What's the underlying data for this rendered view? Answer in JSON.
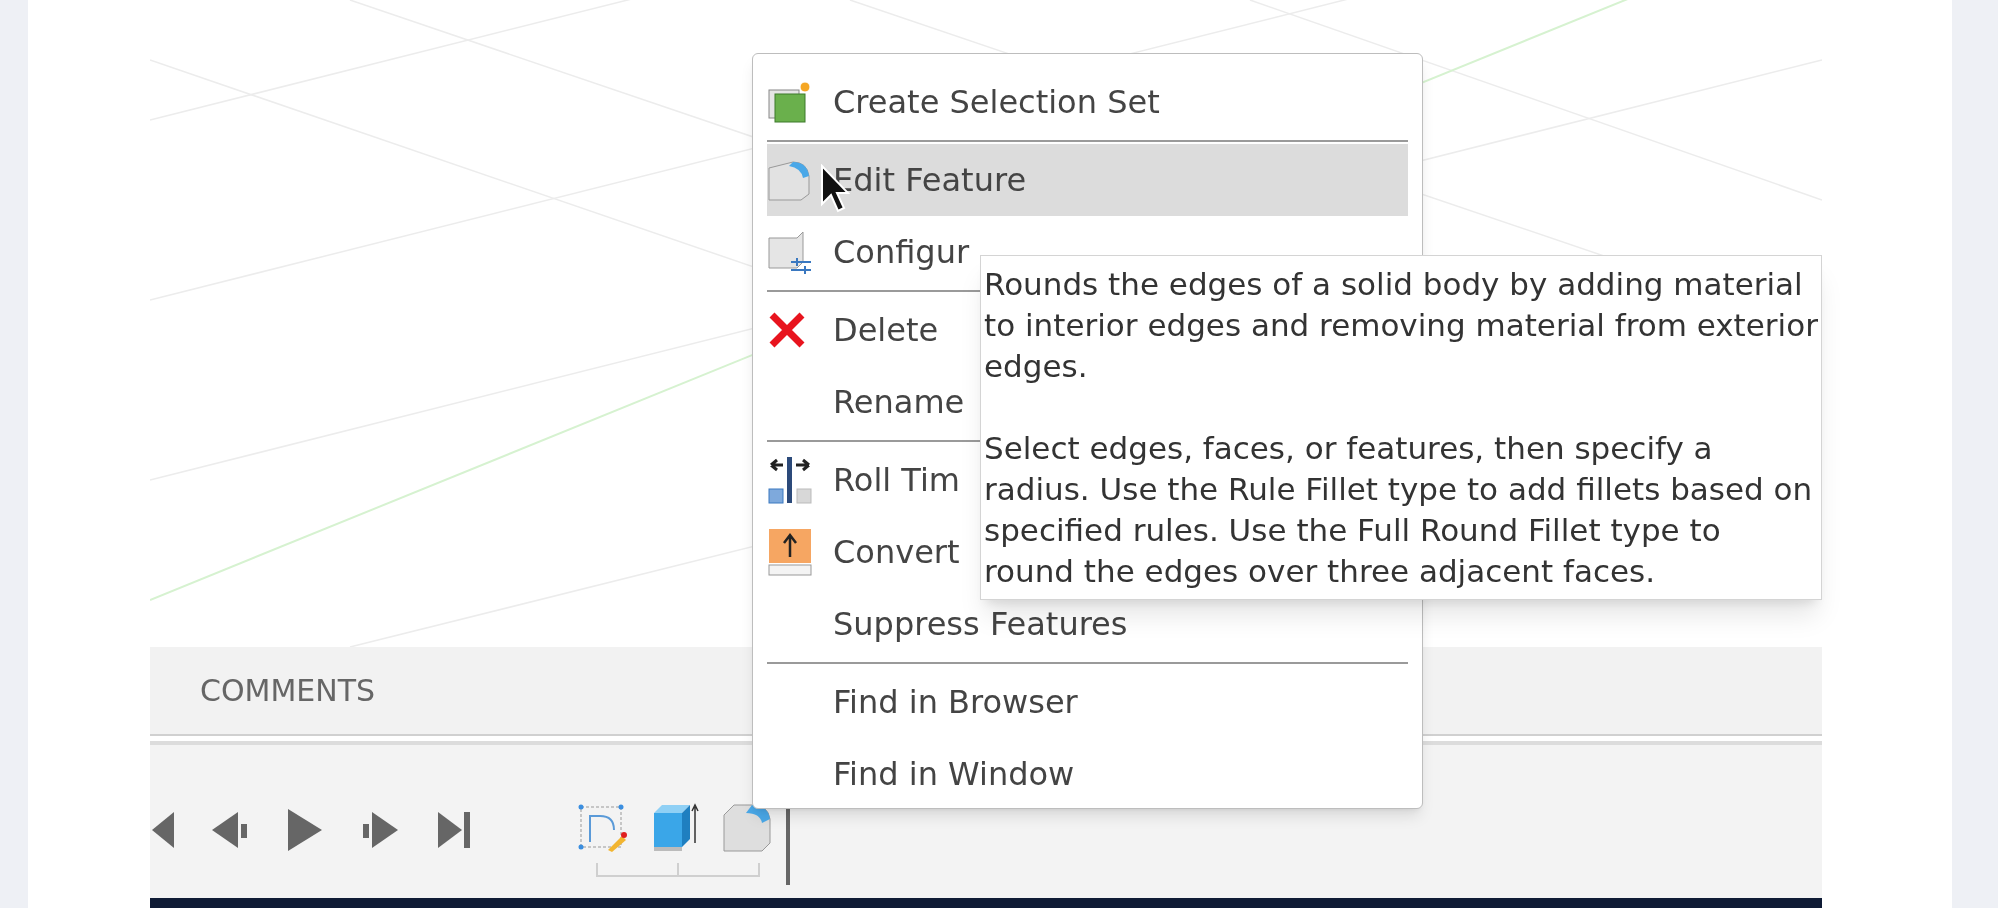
{
  "context_menu": {
    "items": [
      {
        "label": "Create Selection Set",
        "kind": "selection-set",
        "selected": false,
        "separator_after": true
      },
      {
        "label": "Edit Feature",
        "kind": "fillet",
        "selected": true,
        "separator_after": false
      },
      {
        "label": "Configur",
        "kind": "configure",
        "selected": false,
        "separator_after": true
      },
      {
        "label": "Delete",
        "kind": "delete",
        "selected": false,
        "separator_after": false
      },
      {
        "label": "Rename",
        "kind": "none",
        "selected": false,
        "separator_after": true
      },
      {
        "label": "Roll Tim",
        "kind": "roll",
        "selected": false,
        "separator_after": false
      },
      {
        "label": "Convert",
        "kind": "convert",
        "selected": false,
        "separator_after": false
      },
      {
        "label": "Suppress Features",
        "kind": "none",
        "selected": false,
        "separator_after": true
      },
      {
        "label": "Find in Browser",
        "kind": "none",
        "selected": false,
        "separator_after": false
      },
      {
        "label": "Find in Window",
        "kind": "none",
        "selected": false,
        "separator_after": false
      }
    ]
  },
  "tooltip": {
    "paragraphs": [
      "Rounds the edges of a solid body by adding material to interior edges and removing material from exterior edges.",
      "Select edges, faces, or features, then specify a radius. Use the Rule Fillet type to add fillets based on specified rules. Use the Full Round Fillet type to round the edges over three adjacent faces."
    ]
  },
  "comments_panel": {
    "title": "COMMENTS"
  },
  "timeline": {
    "controls": [
      {
        "kind": "first"
      },
      {
        "kind": "previous"
      },
      {
        "kind": "play"
      },
      {
        "kind": "next"
      },
      {
        "kind": "last"
      }
    ],
    "features": [
      {
        "kind": "sketch"
      },
      {
        "kind": "extrude"
      },
      {
        "kind": "fillet"
      }
    ]
  }
}
